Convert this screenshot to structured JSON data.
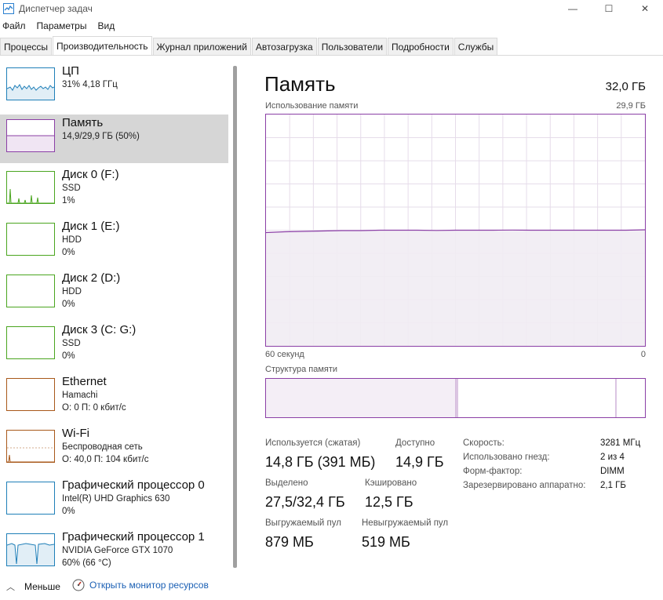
{
  "window": {
    "title": "Диспетчер задач",
    "controls": [
      "—",
      "☐",
      "✕"
    ]
  },
  "menu": [
    "Файл",
    "Параметры",
    "Вид"
  ],
  "tabs": [
    "Процессы",
    "Производительность",
    "Журнал приложений",
    "Автозагрузка",
    "Пользователи",
    "Подробности",
    "Службы"
  ],
  "active_tab_index": 1,
  "sidebar": [
    {
      "title": "ЦП",
      "lines": [
        "31% 4,18 ГГц"
      ],
      "color": "#1f7fb8",
      "graph": "cpu"
    },
    {
      "title": "Память",
      "lines": [
        "14,9/29,9 ГБ (50%)"
      ],
      "color": "#8b3fa6",
      "graph": "mem",
      "selected": true
    },
    {
      "title": "Диск 0 (F:)",
      "lines": [
        "SSD",
        "1%"
      ],
      "color": "#4aa51f",
      "graph": "disk0"
    },
    {
      "title": "Диск 1 (E:)",
      "lines": [
        "HDD",
        "0%"
      ],
      "color": "#4aa51f",
      "graph": "none"
    },
    {
      "title": "Диск 2 (D:)",
      "lines": [
        "HDD",
        "0%"
      ],
      "color": "#4aa51f",
      "graph": "none"
    },
    {
      "title": "Диск 3 (C: G:)",
      "lines": [
        "SSD",
        "0%"
      ],
      "color": "#4aa51f",
      "graph": "none"
    },
    {
      "title": "Ethernet",
      "lines": [
        "Hamachi",
        "О: 0 П: 0 кбит/с"
      ],
      "color": "#a8581a",
      "graph": "none"
    },
    {
      "title": "Wi-Fi",
      "lines": [
        "Беспроводная сеть",
        "О: 40,0 П: 104 кбит/с"
      ],
      "color": "#a8581a",
      "graph": "wifi"
    },
    {
      "title": "Графический процессор 0",
      "lines": [
        "Intel(R) UHD Graphics 630",
        "0%"
      ],
      "color": "#1f7fb8",
      "graph": "none"
    },
    {
      "title": "Графический процессор 1",
      "lines": [
        "NVIDIA GeForce GTX 1070",
        "60% (66 °C)"
      ],
      "color": "#1f7fb8",
      "graph": "gpu1"
    }
  ],
  "memory": {
    "title": "Память",
    "total": "32,0 ГБ",
    "usage_label": "Использование памяти",
    "usage_max": "29,9 ГБ",
    "time_left": "60 секунд",
    "time_right": "0",
    "structure_label": "Структура памяти",
    "usage_fraction": 0.5,
    "stats": {
      "in_use_label": "Используется (сжатая)",
      "in_use_value": "14,8 ГБ (391 МБ)",
      "available_label": "Доступно",
      "available_value": "14,9 ГБ",
      "committed_label": "Выделено",
      "committed_value": "27,5/32,4 ГБ",
      "cached_label": "Кэшировано",
      "cached_value": "12,5 ГБ",
      "paged_label": "Выгружаемый пул",
      "paged_value": "879 МБ",
      "nonpaged_label": "Невыгружаемый пул",
      "nonpaged_value": "519 МБ"
    },
    "details": [
      {
        "label": "Скорость:",
        "value": "3281 МГц"
      },
      {
        "label": "Использовано гнезд:",
        "value": "2 из 4"
      },
      {
        "label": "Форм-фактор:",
        "value": "DIMM"
      },
      {
        "label": "Зарезервировано аппаратно:",
        "value": "2,1 ГБ"
      }
    ]
  },
  "footer": {
    "fewer_label": "Меньше",
    "resmon_label": "Открыть монитор ресурсов"
  }
}
